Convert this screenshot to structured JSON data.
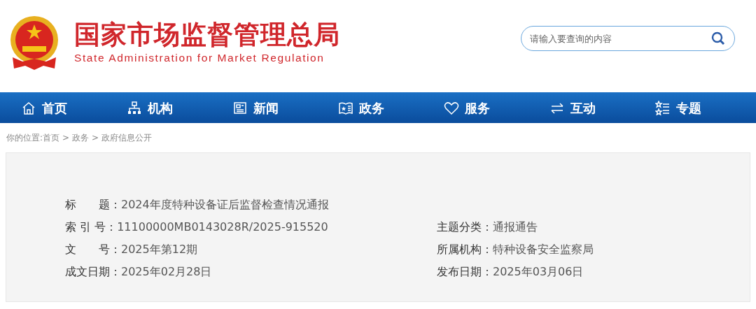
{
  "header": {
    "title": "国家市场监督管理总局",
    "subtitle": "State Administration for Market Regulation"
  },
  "search": {
    "placeholder": "请输入要查询的内容"
  },
  "nav": [
    {
      "label": "首页",
      "kind": "home"
    },
    {
      "label": "机构",
      "kind": "org"
    },
    {
      "label": "新闻",
      "kind": "news"
    },
    {
      "label": "政务",
      "kind": "affairs"
    },
    {
      "label": "服务",
      "kind": "heart"
    },
    {
      "label": "互动",
      "kind": "arrows"
    },
    {
      "label": "专题",
      "kind": "topics"
    }
  ],
  "breadcrumb": {
    "prefix": "你的位置:",
    "separator": ">",
    "items": [
      "首页",
      "政务",
      "政府信息公开"
    ]
  },
  "info": [
    [
      {
        "label": "标　　题：",
        "value": "2024年度特种设备证后监督检查情况通报"
      }
    ],
    [
      {
        "label": "索 引 号：",
        "value": "11100000MB0143028R/2025-915520"
      },
      {
        "label": "主题分类：",
        "value": "通报通告"
      }
    ],
    [
      {
        "label": "文　　号：",
        "value": "2025年第12期"
      },
      {
        "label": "所属机构：",
        "value": "特种设备安全监察局"
      }
    ],
    [
      {
        "label": "成文日期：",
        "value": "2025年02月28日"
      },
      {
        "label": "发布日期：",
        "value": "2025年03月06日"
      }
    ]
  ]
}
